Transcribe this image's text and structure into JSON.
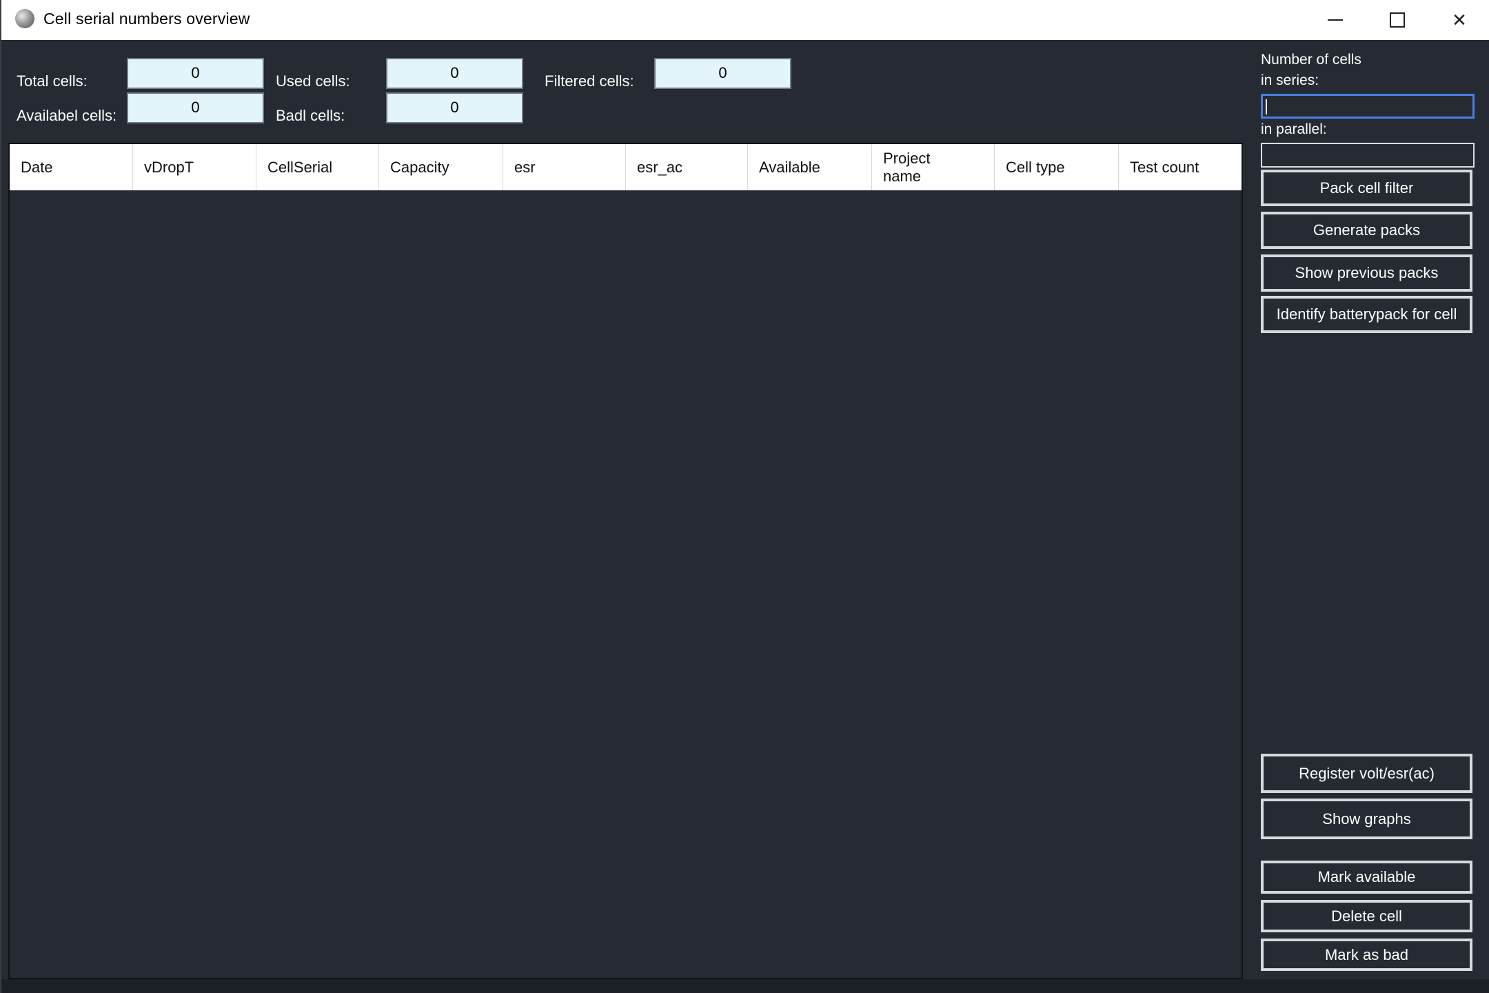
{
  "window": {
    "title": "Cell serial numbers overview",
    "controls": {
      "minimize": "minimize",
      "maximize": "maximize",
      "close": "✕"
    }
  },
  "stats": {
    "total_label": "Total cells:",
    "total_value": "0",
    "available_label": "Availabel cells:",
    "available_value": "0",
    "used_label": "Used cells:",
    "used_value": "0",
    "bad_label": "Badl cells:",
    "bad_value": "0",
    "filtered_label": "Filtered cells:",
    "filtered_value": "0"
  },
  "table": {
    "columns": [
      "Date",
      "vDropT",
      "CellSerial",
      "Capacity",
      "esr",
      "esr_ac",
      "Available",
      "Project\nname",
      "Cell type",
      "Test count"
    ],
    "rows": []
  },
  "sidebar": {
    "number_of_cells_label": "Number of cells",
    "in_series_label": "in series:",
    "in_series_value": "",
    "in_parallel_label": "in parallel:",
    "in_parallel_value": "",
    "buttons_top": [
      "Pack cell filter",
      "Generate packs",
      "Show previous packs",
      "Identify batterypack for cell"
    ],
    "buttons_bottom": [
      "Register volt/esr(ac)",
      "Show graphs",
      "Mark available",
      "Delete cell",
      "Mark as bad"
    ]
  }
}
